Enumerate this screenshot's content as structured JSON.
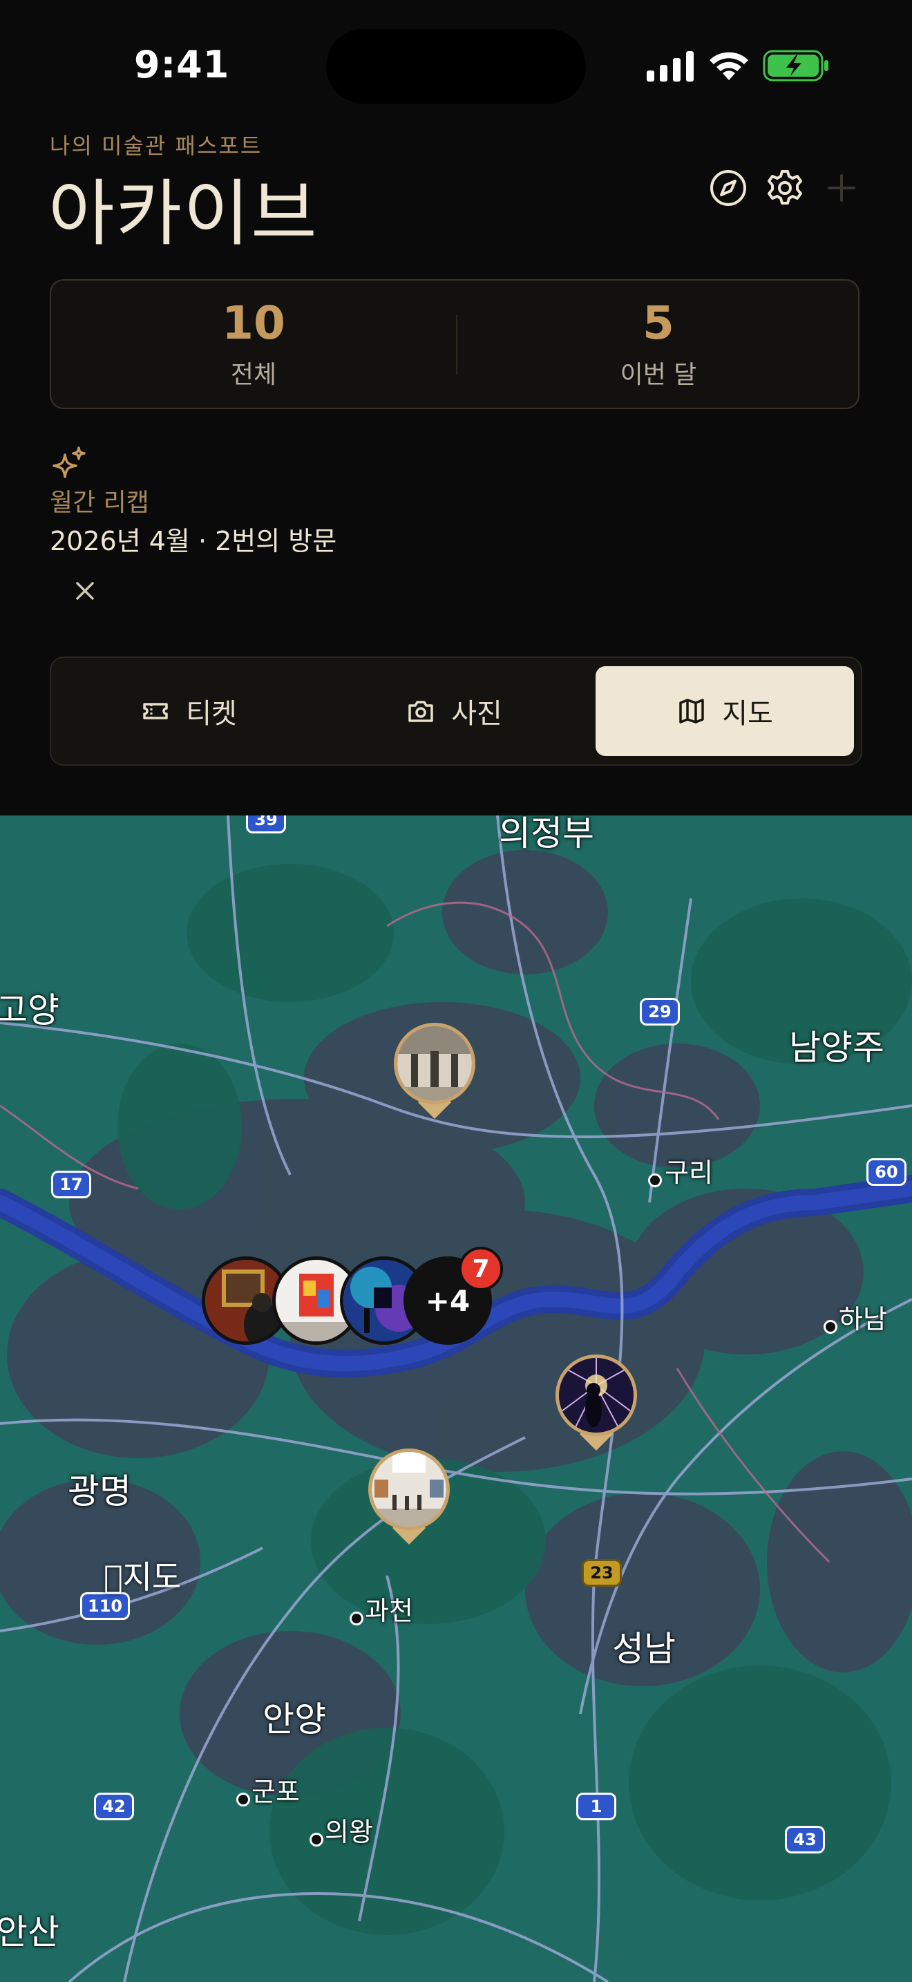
{
  "status_bar": {
    "time": "9:41"
  },
  "header": {
    "subtitle": "나의 미술관 패스포트",
    "title": "아카이브"
  },
  "stats": [
    {
      "value": "10",
      "label": "전체"
    },
    {
      "value": "5",
      "label": "이번 달"
    }
  ],
  "recap": {
    "label": "월간 리캡",
    "text": "2026년 4월 · 2번의 방문"
  },
  "tabs": [
    {
      "label": "티켓",
      "icon": "ticket-icon",
      "active": false
    },
    {
      "label": "사진",
      "icon": "camera-icon",
      "active": false
    },
    {
      "label": "지도",
      "icon": "map-icon",
      "active": true
    }
  ],
  "map": {
    "brand": "지도",
    "cities": {
      "uijeongbu": "의정부",
      "goyang": "고양",
      "namyangju": "남양주",
      "guri": "구리",
      "hanam": "하남",
      "gwangmyeong": "광명",
      "gwacheon": "과천",
      "seongnam": "성남",
      "anyang": "안양",
      "gunpo": "군포",
      "uiwang": "의왕",
      "ansan": "안산"
    },
    "shields": {
      "s39": "39",
      "s29": "29",
      "s17": "17",
      "s60": "60",
      "s110": "110",
      "s23": "23",
      "s42": "42",
      "s1": "1",
      "s43": "43"
    },
    "cluster": {
      "more": "+4",
      "badge": "7"
    }
  },
  "colors": {
    "accent": "#c69a5d",
    "active_tab_bg": "#efe6d4",
    "badge": "#e5352b"
  }
}
